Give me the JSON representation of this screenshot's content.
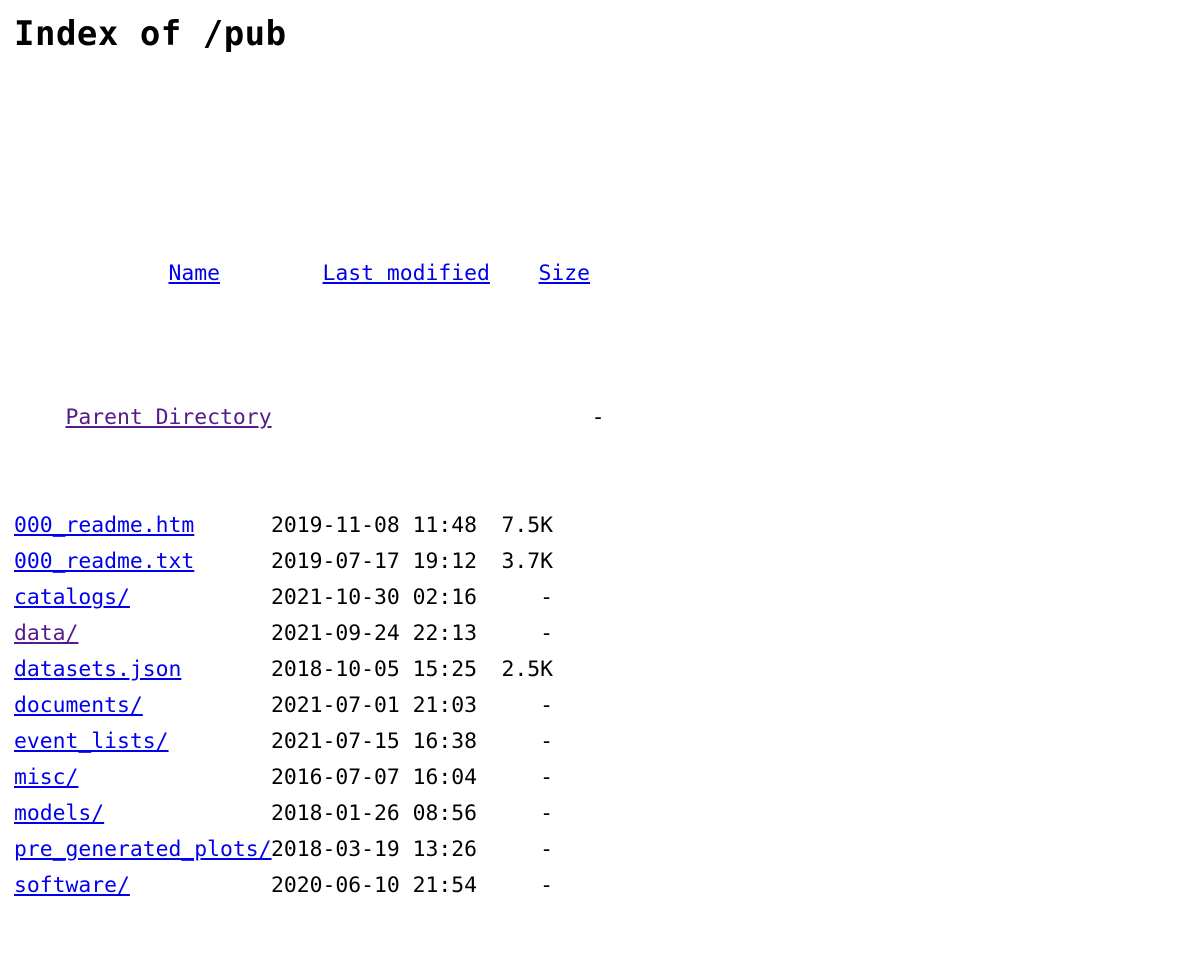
{
  "page": {
    "title": "Index of /pub"
  },
  "table": {
    "headers": {
      "name": "Name",
      "last_modified": "Last modified",
      "size": "Size"
    },
    "parent": {
      "label": "Parent Directory",
      "last_modified": "",
      "size": "-",
      "visited": true
    },
    "rows": [
      {
        "name": "000_readme.htm",
        "last_modified": "2019-11-08 11:48",
        "size": "7.5K",
        "visited": false
      },
      {
        "name": "000_readme.txt",
        "last_modified": "2019-07-17 19:12",
        "size": "3.7K",
        "visited": false
      },
      {
        "name": "catalogs/",
        "last_modified": "2021-10-30 02:16",
        "size": "-",
        "visited": false
      },
      {
        "name": "data/",
        "last_modified": "2021-09-24 22:13",
        "size": "-",
        "visited": true
      },
      {
        "name": "datasets.json",
        "last_modified": "2018-10-05 15:25",
        "size": "2.5K",
        "visited": false
      },
      {
        "name": "documents/",
        "last_modified": "2021-07-01 21:03",
        "size": "-",
        "visited": false
      },
      {
        "name": "event_lists/",
        "last_modified": "2021-07-15 16:38",
        "size": "-",
        "visited": false
      },
      {
        "name": "misc/",
        "last_modified": "2016-07-07 16:04",
        "size": "-",
        "visited": false
      },
      {
        "name": "models/",
        "last_modified": "2018-01-26 08:56",
        "size": "-",
        "visited": false
      },
      {
        "name": "pre_generated_plots/",
        "last_modified": "2018-03-19 13:26",
        "size": "-",
        "visited": false
      },
      {
        "name": "software/",
        "last_modified": "2020-06-10 21:54",
        "size": "-",
        "visited": false
      }
    ]
  },
  "colors": {
    "link": "#0000EE",
    "visited_link": "#551A8B",
    "text": "#000000",
    "background": "#FFFFFF"
  }
}
